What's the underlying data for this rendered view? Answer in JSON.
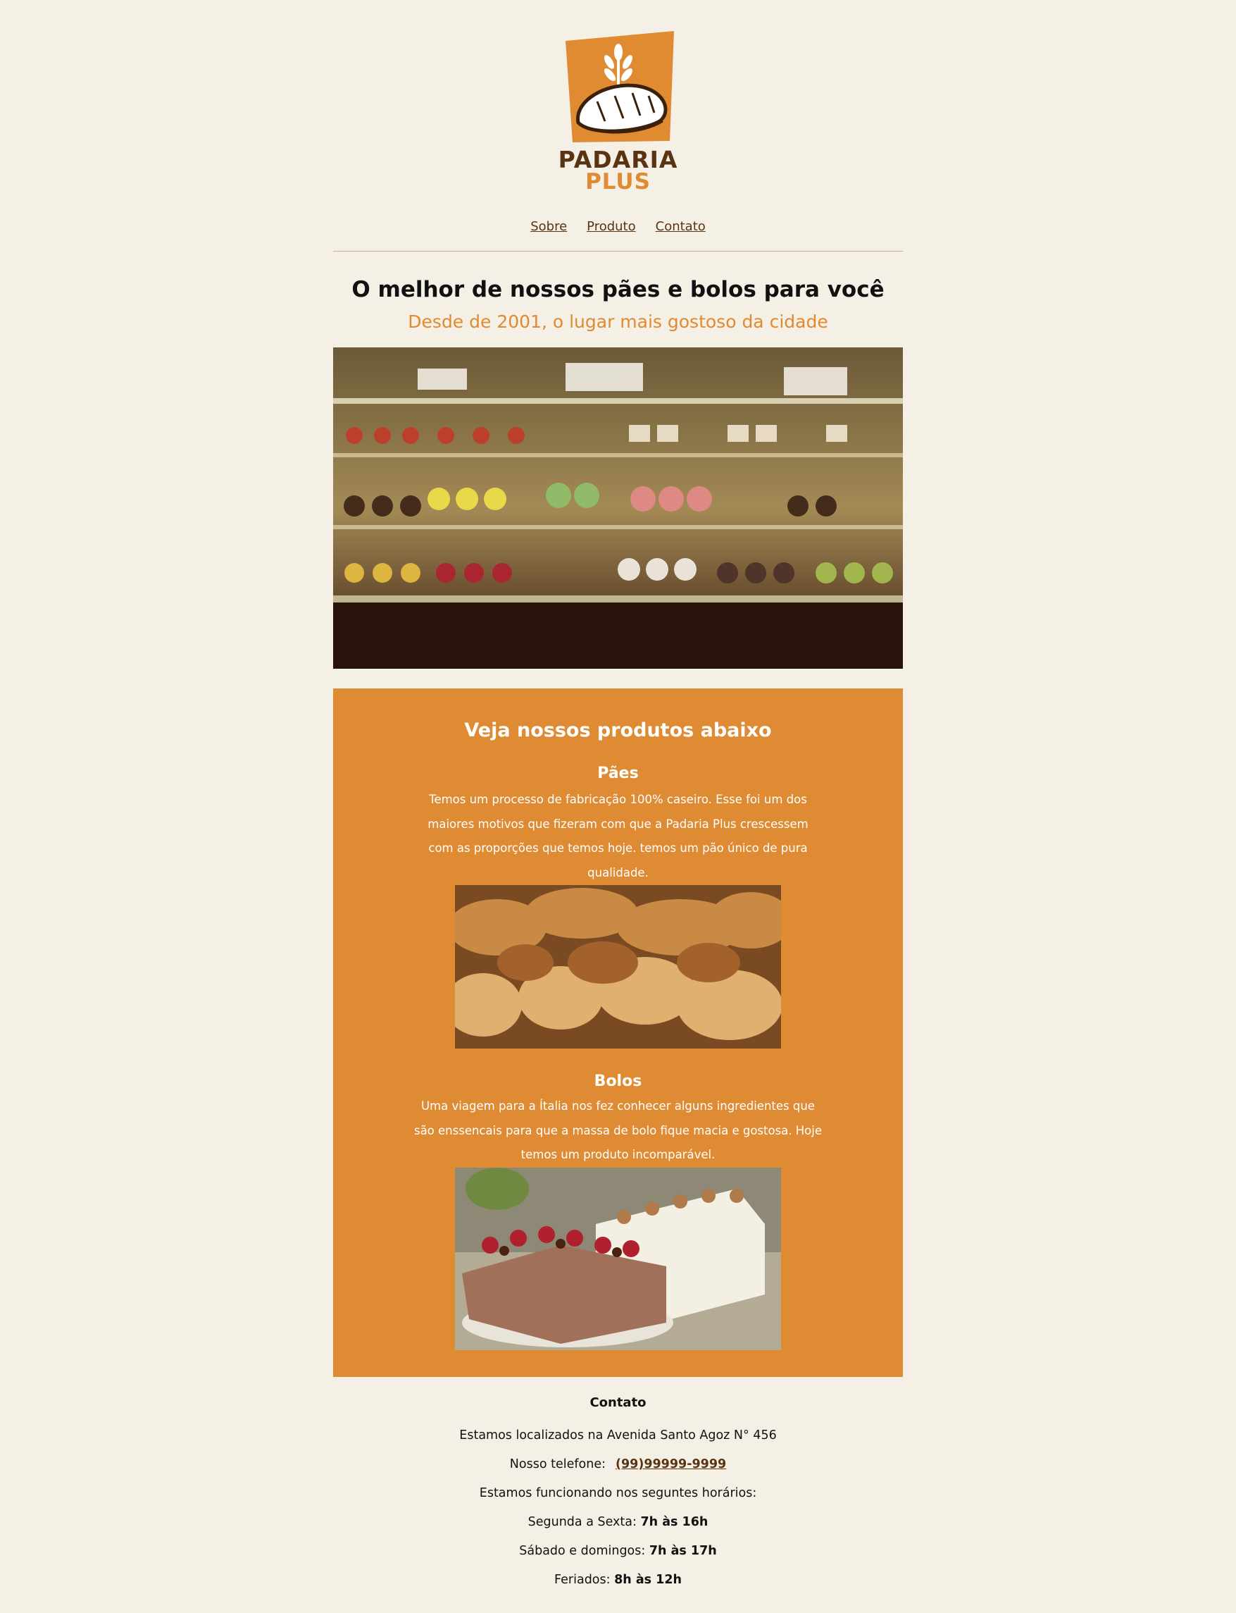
{
  "brand": {
    "logo_text_top": "PADARIA",
    "logo_text_bottom": "PLUS",
    "color_primary": "#de8b34",
    "color_dark": "#5a3412",
    "color_bg": "#f5f0e6"
  },
  "nav": {
    "items": [
      {
        "label": "Sobre"
      },
      {
        "label": "Produto"
      },
      {
        "label": "Contato"
      }
    ]
  },
  "hero": {
    "title": "O melhor de nossos pães e bolos para você",
    "subtitle": "Desde de 2001, o lugar mais gostoso da cidade"
  },
  "products": {
    "heading": "Veja nossos produtos abaixo",
    "items": [
      {
        "title": "Pães",
        "description": "Temos um processo de fabricação 100% caseiro. Esse foi um dos maiores motivos que fizeram com que a Padaria Plus crescessem com as proporções que temos hoje. temos um pão único de pura qualidade."
      },
      {
        "title": "Bolos",
        "description": "Uma viagem para a Ítalia nos fez conhecer alguns ingredientes que são enssencais para que a massa de bolo fique macia e gostosa. Hoje temos um produto incomparável."
      }
    ]
  },
  "contact": {
    "title": "Contato",
    "address": "Estamos localizados na Avenida Santo Agoz N° 456",
    "phone_label": "Nosso telefone:",
    "phone": "(99)99999-9999",
    "hours_intro": "Estamos funcionando nos seguntes horários:",
    "hours": [
      {
        "label": "Segunda a Sexta:",
        "value": "7h às 16h"
      },
      {
        "label": "Sábado e domingos:",
        "value": "7h às 17h"
      },
      {
        "label": "Feriados:",
        "value": "8h às 12h"
      }
    ]
  }
}
